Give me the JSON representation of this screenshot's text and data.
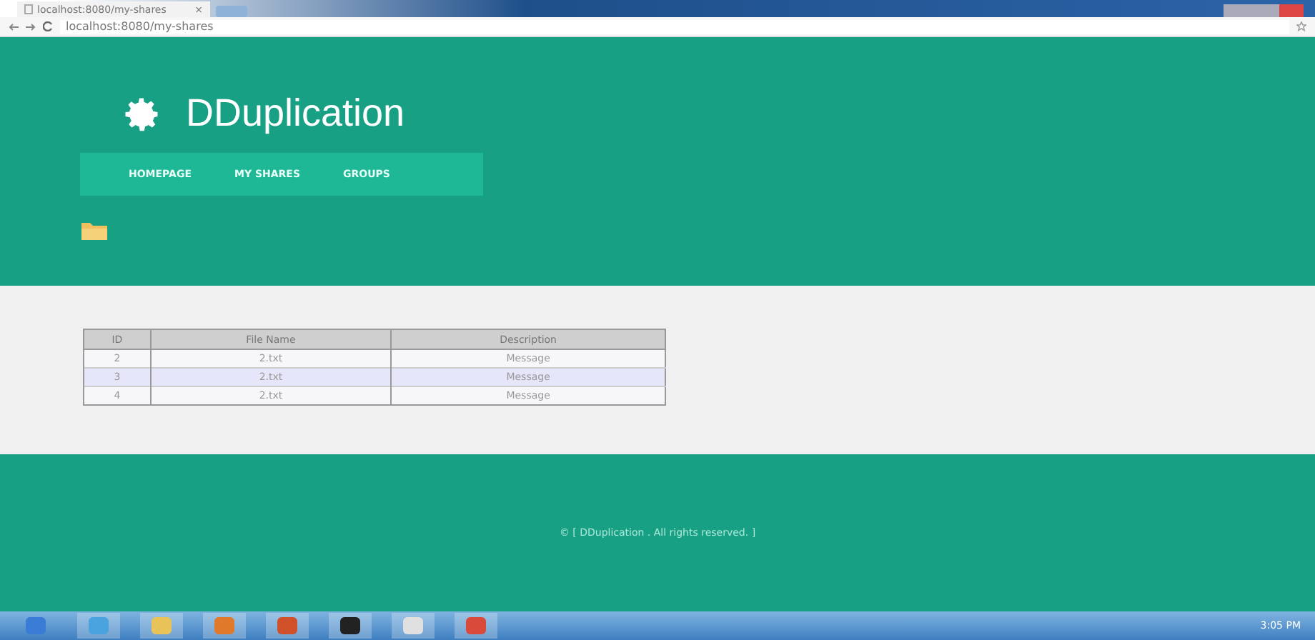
{
  "browser": {
    "tab_title": "localhost:8080/my-shares",
    "tab_close": "×",
    "address": "localhost:8080/my-shares"
  },
  "header": {
    "brand": "DDuplication",
    "nav": [
      {
        "label": "HOMEPAGE"
      },
      {
        "label": "MY SHARES"
      },
      {
        "label": "GROUPS"
      }
    ]
  },
  "table": {
    "columns": [
      "ID",
      "File Name",
      "Description"
    ],
    "rows": [
      {
        "cells": [
          "2",
          "2.txt",
          "Message"
        ],
        "selected": false
      },
      {
        "cells": [
          "3",
          "2.txt",
          "Message"
        ],
        "selected": true
      },
      {
        "cells": [
          "4",
          "2.txt",
          "Message"
        ],
        "selected": false
      }
    ]
  },
  "footer": {
    "text": "© [ DDuplication . All rights reserved. ]"
  },
  "taskbar": {
    "clock": "3:05 PM"
  }
}
